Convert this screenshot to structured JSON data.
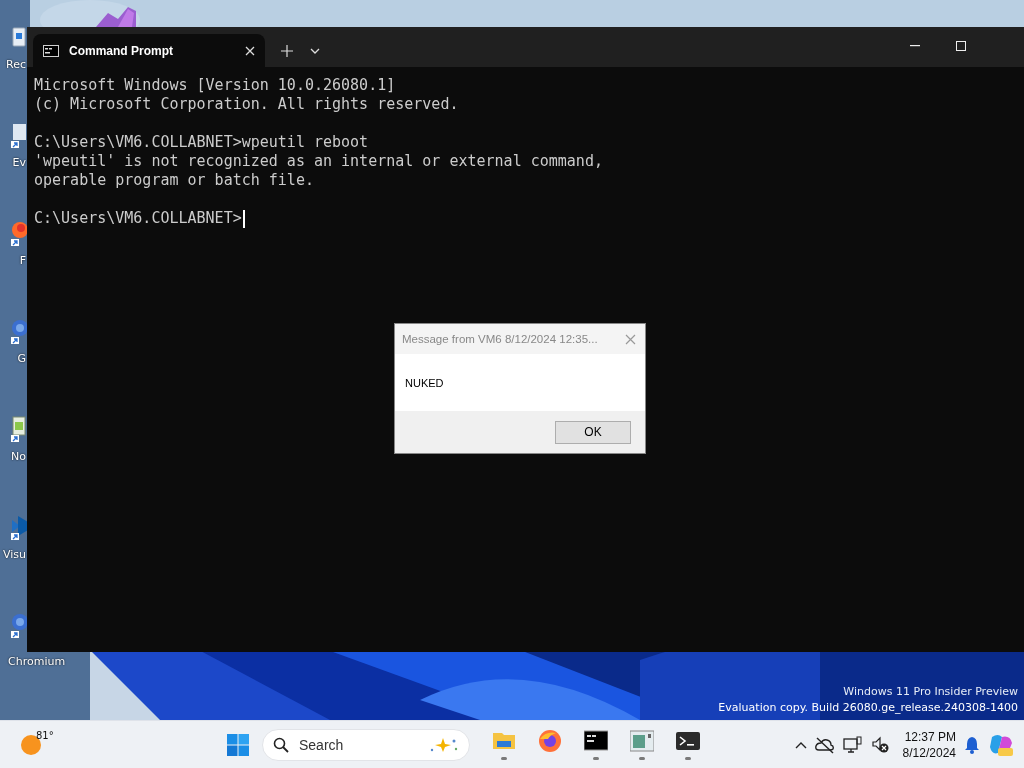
{
  "desktop": {
    "icons": [
      {
        "kind": "bin",
        "label": "Rec"
      },
      {
        "kind": "doc",
        "label": "Ev"
      },
      {
        "kind": "fox",
        "label": "F"
      },
      {
        "kind": "globe",
        "label": "G"
      },
      {
        "kind": "note",
        "label": "No"
      },
      {
        "kind": "code",
        "label": "Visu"
      },
      {
        "kind": "globe",
        "label": "Chromium"
      }
    ],
    "top_icon": {
      "kind": "studio"
    },
    "watermark": [
      "Windows 11 Pro Insider Preview",
      "Evaluation copy. Build 26080.ge_release.240308-1400"
    ]
  },
  "window": {
    "tab_title": "Command Prompt",
    "terminal": {
      "blocks": [
        [
          "Microsoft Windows [Version 10.0.26080.1]",
          "(c) Microsoft Corporation. All rights reserved."
        ],
        [
          "C:\\Users\\VM6.COLLABNET>wpeutil reboot",
          "'wpeutil' is not recognized as an internal or external command,",
          "operable program or batch file."
        ],
        [
          "C:\\Users\\VM6.COLLABNET>"
        ]
      ],
      "cursor": true
    }
  },
  "dialog": {
    "title": "Message from VM6 8/12/2024 12:35...",
    "message": "NUKED",
    "buttons": [
      "OK"
    ]
  },
  "taskbar": {
    "weather": "81°",
    "search": {
      "placeholder": "Search"
    },
    "apps": [
      {
        "kind": "explorer",
        "running": true
      },
      {
        "kind": "firefox",
        "running": false
      },
      {
        "kind": "cmd",
        "running": true
      },
      {
        "kind": "window",
        "running": true
      },
      {
        "kind": "terminal",
        "running": true
      }
    ],
    "time": "12:37 PM",
    "date": "8/12/2024"
  }
}
